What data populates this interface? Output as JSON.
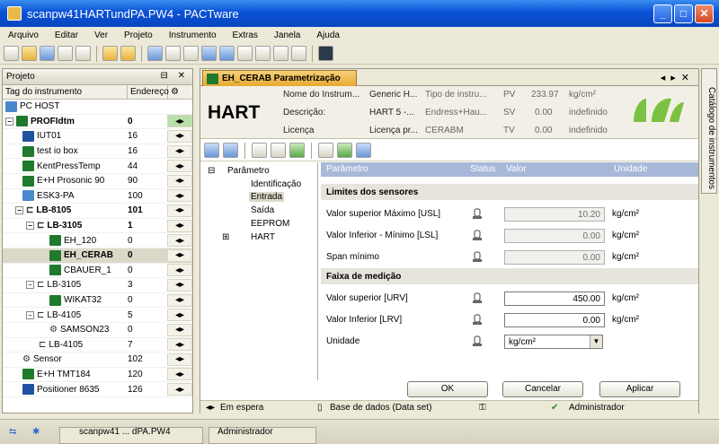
{
  "window": {
    "title": "scanpw41HARTundPA.PW4 - PACTware"
  },
  "menu": [
    "Arquivo",
    "Editar",
    "Ver",
    "Projeto",
    "Instrumento",
    "Extras",
    "Janela",
    "Ajuda"
  ],
  "project": {
    "title": "Projeto",
    "col_tag": "Tag do instrumento",
    "col_address": "Endereço",
    "rows": [
      {
        "name": "PC HOST",
        "addr": ""
      },
      {
        "name": "PROFIdtm",
        "addr": "0"
      },
      {
        "name": "IUT01",
        "addr": "16"
      },
      {
        "name": "test io box",
        "addr": "16"
      },
      {
        "name": "KentPressTemp",
        "addr": "44"
      },
      {
        "name": "E+H Prosonic 90",
        "addr": "90"
      },
      {
        "name": "ESK3-PA",
        "addr": "100"
      },
      {
        "name": "LB-8105",
        "addr": "101"
      },
      {
        "name": "LB-3105",
        "addr": "1"
      },
      {
        "name": "EH_120",
        "addr": "0"
      },
      {
        "name": "EH_CERAB",
        "addr": "0"
      },
      {
        "name": "CBAUER_1",
        "addr": "0"
      },
      {
        "name": "LB-3105",
        "addr": "3"
      },
      {
        "name": "WIKAT32",
        "addr": "0"
      },
      {
        "name": "LB-4105",
        "addr": "5"
      },
      {
        "name": "SAMSON23",
        "addr": "0"
      },
      {
        "name": "LB-4105",
        "addr": "7"
      },
      {
        "name": "Sensor",
        "addr": "102"
      },
      {
        "name": "E+H TMT184",
        "addr": "120"
      },
      {
        "name": "Positioner 8635",
        "addr": "126"
      }
    ]
  },
  "doc": {
    "tab_title": "EH_CERAB Parametrização",
    "hart": "HART",
    "info": {
      "name_label": "Nome do Instrum...",
      "name_value": "Generic H...",
      "desc_label": "Descrição:",
      "desc_value": "HART 5 -...",
      "lic_label": "Licença",
      "lic_value": "Licença pr...",
      "type_label": "Tipo de instru...",
      "maker": "Endress+Hau...",
      "device": "CERABM",
      "pv_label": "PV",
      "pv_value": "233.97",
      "pv_unit": "kg/cm²",
      "sv_label": "SV",
      "sv_value": "0.00",
      "sv_unit": "indefinido",
      "tv_label": "TV",
      "tv_value": "0.00",
      "tv_unit": "indefinido"
    },
    "tree": {
      "root": "Parâmetro",
      "items": [
        "Identificação",
        "Entrada",
        "Saída",
        "EEPROM",
        "HART"
      ]
    },
    "grid": {
      "h_param": "Parâmetro",
      "h_status": "Status",
      "h_value": "Valor",
      "h_unit": "Unidade",
      "sec1": "Limites dos sensores",
      "sec2": "Faixa de medição",
      "usl_label": "Valor superior Máximo [USL]",
      "usl_value": "10.20",
      "usl_unit": "kg/cm²",
      "lsl_label": "Valor Inferior - Mínimo [LSL]",
      "lsl_value": "0.00",
      "lsl_unit": "kg/cm²",
      "span_label": "Span mínimo",
      "span_value": "0.00",
      "span_unit": "kg/cm²",
      "urv_label": "Valor superior [URV]",
      "urv_value": "450.00",
      "urv_unit": "kg/cm²",
      "lrv_label": "Valor Inferior [LRV]",
      "lrv_value": "0.00",
      "lrv_unit": "kg/cm²",
      "unit_label": "Unidade",
      "unit_value": "kg/cm²"
    },
    "buttons": {
      "ok": "OK",
      "cancel": "Cancelar",
      "apply": "Aplicar"
    },
    "status": {
      "wait": "Em espera",
      "dataset": "Base de dados (Data set)",
      "user": "Administrador"
    }
  },
  "sidetab": "Catálogo de instrumentos",
  "bottom": {
    "file": "scanpw41 ... dPA.PW4",
    "user": "Administrador"
  }
}
